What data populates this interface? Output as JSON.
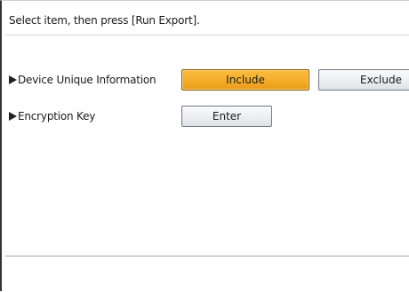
{
  "instruction": "Select item, then press [Run Export].",
  "rows": [
    {
      "label": "Device Unique Information",
      "options": [
        {
          "label": "Include",
          "selected": true
        },
        {
          "label": "Exclude",
          "selected": false
        }
      ]
    },
    {
      "label": "Encryption Key",
      "button_label": "Enter"
    }
  ],
  "colors": {
    "selected_button": "#f3ab27",
    "button_border": "#6f7a86"
  }
}
